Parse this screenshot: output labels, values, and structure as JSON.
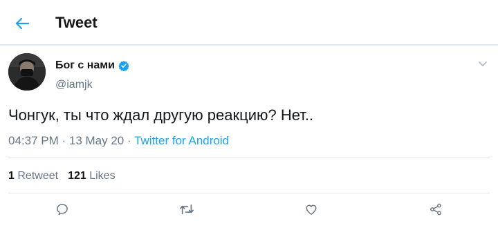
{
  "header": {
    "title": "Tweet",
    "back_icon": "arrow-left-icon",
    "accent": "#1da1f2"
  },
  "tweet": {
    "author_name": "Бог с нами",
    "verified_icon": "verified-badge-icon",
    "handle": "@iamjk",
    "text": "Чонгук, ты что ждал другую реакцию? Нет..",
    "time": "04:37 PM",
    "separator": " · ",
    "date": "13 May 20",
    "source_separator": " · ",
    "source": "Twitter for Android"
  },
  "stats": {
    "retweets_count": "1",
    "retweets_label": "Retweet",
    "likes_count": "121",
    "likes_label": "Likes"
  },
  "actions": [
    {
      "name": "reply",
      "icon": "reply-icon"
    },
    {
      "name": "retweet",
      "icon": "retweet-icon"
    },
    {
      "name": "like",
      "icon": "heart-icon"
    },
    {
      "name": "share",
      "icon": "share-icon"
    }
  ],
  "colors": {
    "text_primary": "#14171a",
    "text_secondary": "#657786",
    "divider": "#e1e8ed",
    "link": "#1da1f2"
  }
}
